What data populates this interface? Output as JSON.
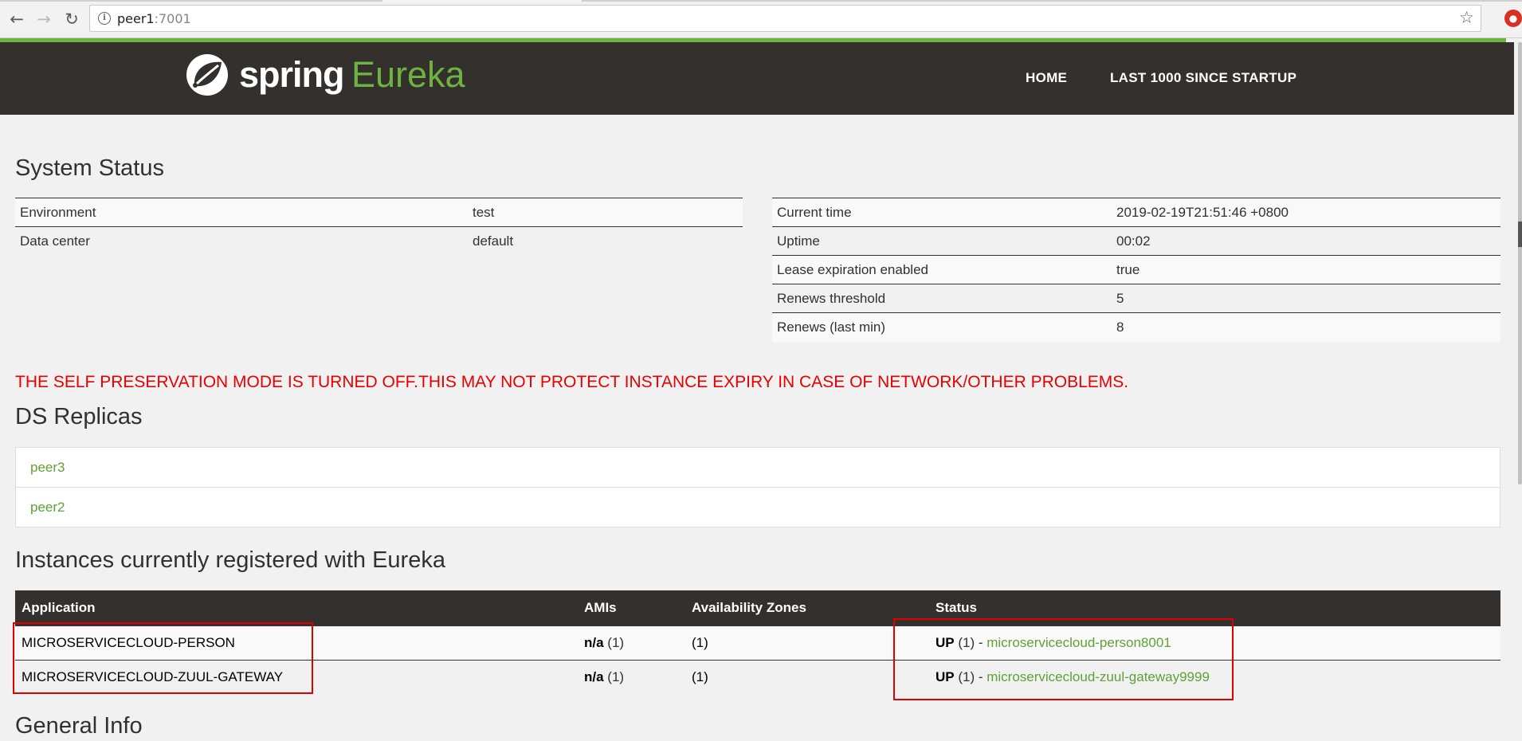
{
  "browser": {
    "url_host": "peer1",
    "url_port": ":7001"
  },
  "navbar": {
    "brand_spring": "spring",
    "brand_eureka": "Eureka",
    "home_label": "HOME",
    "last1000_label": "LAST 1000 SINCE STARTUP"
  },
  "system_status": {
    "title": "System Status",
    "left": [
      {
        "key": "Environment",
        "value": "test"
      },
      {
        "key": "Data center",
        "value": "default"
      }
    ],
    "right": [
      {
        "key": "Current time",
        "value": "2019-02-19T21:51:46 +0800"
      },
      {
        "key": "Uptime",
        "value": "00:02"
      },
      {
        "key": "Lease expiration enabled",
        "value": "true"
      },
      {
        "key": "Renews threshold",
        "value": "5"
      },
      {
        "key": "Renews (last min)",
        "value": "8"
      }
    ]
  },
  "warning": "THE SELF PRESERVATION MODE IS TURNED OFF.THIS MAY NOT PROTECT INSTANCE EXPIRY IN CASE OF NETWORK/OTHER PROBLEMS.",
  "ds_replicas": {
    "title": "DS Replicas",
    "items": [
      "peer3",
      "peer2"
    ]
  },
  "instances": {
    "title": "Instances currently registered with Eureka",
    "headers": [
      "Application",
      "AMIs",
      "Availability Zones",
      "Status"
    ],
    "rows": [
      {
        "application": "MICROSERVICECLOUD-PERSON",
        "amis_na": "n/a",
        "amis_count": " (1)",
        "zones": "(1)",
        "status_up": "UP",
        "status_count": " (1) - ",
        "instance": "microservicecloud-person8001"
      },
      {
        "application": "MICROSERVICECLOUD-ZUUL-GATEWAY",
        "amis_na": "n/a",
        "amis_count": " (1)",
        "zones": "(1)",
        "status_up": "UP",
        "status_count": " (1) - ",
        "instance": "microservicecloud-zuul-gateway9999"
      }
    ]
  },
  "general_info": {
    "title": "General Info"
  },
  "colors": {
    "nav_bg": "#34302d",
    "spring_green": "#6db33f",
    "link_green": "#5fa134",
    "warning_red": "#e80000",
    "annotation_red": "#e00000"
  }
}
